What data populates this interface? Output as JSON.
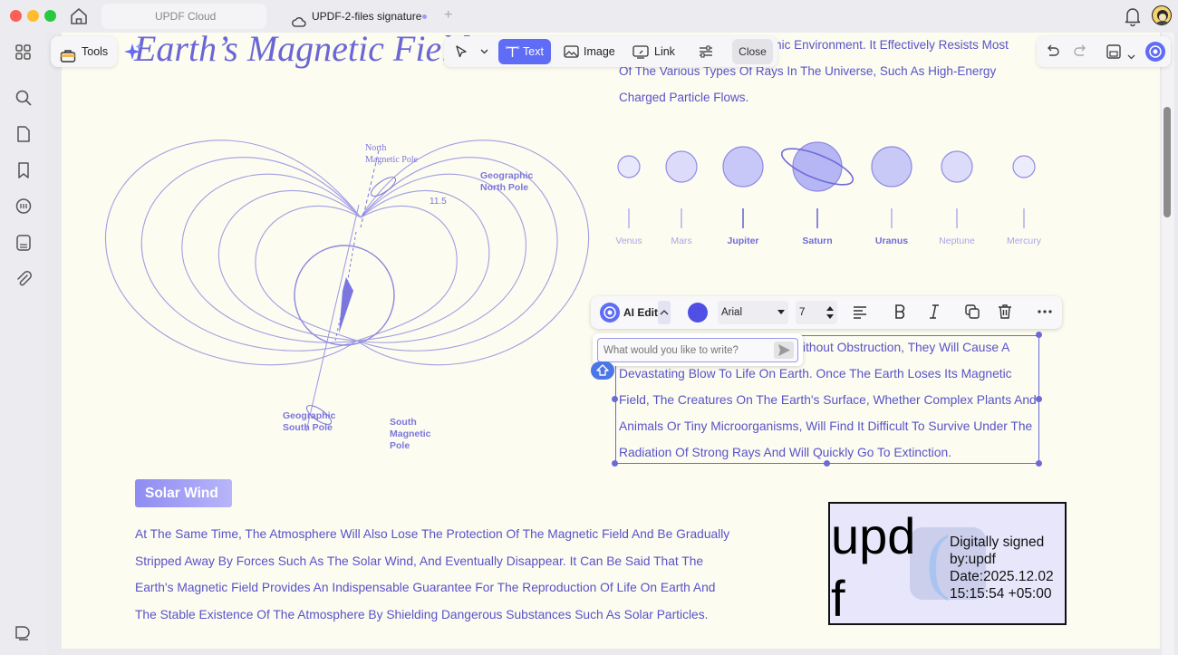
{
  "titlebar": {
    "tabs": [
      {
        "label": "UPDF Cloud"
      },
      {
        "label": "UPDF-2-files signature"
      }
    ]
  },
  "toolbar": {
    "tools_label": "Tools",
    "text_label": "Text",
    "image_label": "Image",
    "link_label": "Link",
    "close_label": "Close"
  },
  "document": {
    "title": "Earth’s Magnetic Field",
    "top_para": [
      "Play A Vital Role In The Cosmic Environment. It Effectively Resists Most",
      "Of The Various Types Of Rays In The Universe, Such As High-Energy",
      "Charged Particle Flows."
    ],
    "diagram": {
      "north_magnetic": [
        "North",
        "Magnetic Pole"
      ],
      "geo_north": [
        "Geographic",
        "North Pole"
      ],
      "angle": "11.5",
      "geo_south": [
        "Geographic",
        "South Pole"
      ],
      "south_magnetic": [
        "South",
        "Magnetic",
        "Pole"
      ]
    },
    "planets": [
      {
        "name": "Venus",
        "color": "#e8e8fc"
      },
      {
        "name": "Mars",
        "color": "#dcdcfa"
      },
      {
        "name": "Jupiter",
        "color": "#c8c8f8"
      },
      {
        "name": "Saturn",
        "color": "#b6b6f4"
      },
      {
        "name": "Uranus",
        "color": "#c9c9f8"
      },
      {
        "name": "Neptune",
        "color": "#dcdcfa"
      },
      {
        "name": "Mercury",
        "color": "#ececfc"
      }
    ],
    "edit_block": [
      "Without Obstruction, They Will Cause A",
      "Devastating Blow To Life On Earth. Once The Earth Loses Its Magnetic",
      "Field, The Creatures On The Earth's Surface, Whether Complex Plants And",
      "Animals Or Tiny Microorganisms, Will Find It Difficult To Survive Under The",
      "Radiation Of Strong Rays And Will Quickly Go To Extinction."
    ],
    "section_badge": "Solar Wind",
    "body": [
      "At The Same Time, The Atmosphere Will Also Lose The Protection Of The Magnetic Field And Be Gradually",
      "Stripped Away By Forces Such As The Solar Wind, And Eventually Disappear. It Can Be Said That The",
      "Earth's Magnetic Field Provides An Indispensable Guarantee For The Reproduction Of Life On Earth And",
      "The Stable Existence Of The Atmosphere By Shielding Dangerous Substances Such As Solar Particles."
    ],
    "signature": {
      "big_text_1": "upd",
      "big_text_2": "f",
      "lines": [
        "Digitally signed",
        "by:updf",
        "Date:2025.12.02",
        "15:15:54 +05:00"
      ]
    }
  },
  "format_bar": {
    "ai_edit_label": "AI Edit",
    "font": "Arial",
    "size": "7",
    "text_color": "#4f4fe6"
  },
  "ai_popup": {
    "placeholder": "What would you like to write?"
  },
  "colors": {
    "accent": "#5f6cf5",
    "doc_text": "#5753c9"
  }
}
